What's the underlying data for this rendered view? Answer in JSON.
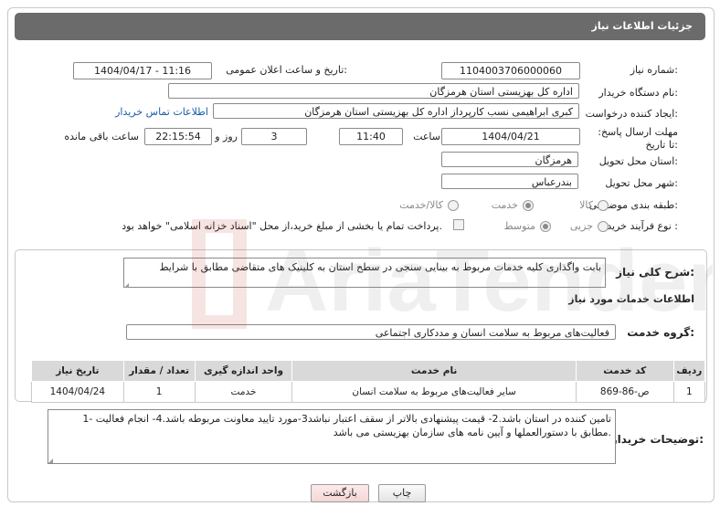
{
  "header": {
    "title": "جزئیات اطلاعات نیاز"
  },
  "fields": {
    "need_number_label": "شماره نیاز:",
    "need_number": "1104003706000060",
    "announce_label": "تاریخ و ساعت اعلان عمومی:",
    "announce_value": "1404/04/17 - 11:16",
    "buyer_label": "نام دستگاه خریدار:",
    "buyer_value": "اداره کل بهزیستی استان هرمزگان",
    "creator_label": "ایجاد کننده درخواست:",
    "creator_value": "کبری  ابراهیمی نسب کارپرداز اداره کل بهزیستی استان هرمزگان",
    "contact_link": "اطلاعات تماس خریدار",
    "deadline_label": "مهلت ارسال پاسخ: تا تاریخ:",
    "deadline_date": "1404/04/21",
    "time_label": "ساعت",
    "deadline_time": "11:40",
    "days_value": "3",
    "days_label": "روز و",
    "remaining_time": "22:15:54",
    "remaining_label": "ساعت باقی مانده",
    "province_label": "استان محل تحویل:",
    "province_value": "هرمزگان",
    "city_label": "شهر محل تحویل:",
    "city_value": "بندرعباس",
    "category_label": "طبقه بندی موضوعی:",
    "category_options": [
      "کالا",
      "خدمت",
      "کالا/خدمت"
    ],
    "process_label": "نوع فرآیند خرید :",
    "process_options": [
      "جزیی",
      "متوسط"
    ],
    "payment_note": "پرداخت تمام یا بخشی از مبلغ خرید،از محل \"اسناد خزانه اسلامی\" خواهد بود."
  },
  "summary": {
    "label": "شرح کلی نیاز:",
    "value": "بابت واگذاری کلیه خدمات مربوط به  بینایی سنجی در سطح استان به کلینیک های متقاضی مطابق با شرایط"
  },
  "services": {
    "section_title": "اطلاعات خدمات مورد نیاز",
    "group_label": "گروه خدمت:",
    "group_value": "فعالیت‌های مربوط به سلامت انسان و مددکاری اجتماعی",
    "columns": [
      "ردیف",
      "کد خدمت",
      "نام خدمت",
      "واحد اندازه گیری",
      "تعداد / مقدار",
      "تاریخ نیاز"
    ],
    "rows": [
      [
        "1",
        "ص-86-869",
        "سایر فعالیت‌های مربوط به سلامت انسان",
        "خدمت",
        "1",
        "1404/04/24"
      ]
    ]
  },
  "notes": {
    "label": "توضیحات خریدار:",
    "value": "1- تامین کننده در استان  باشد.2- قیمت پیشنهادی بالاتر از سقف اعتبار نباشد3-مورد تایید معاونت مربوطه باشد.4- انجام فعالیت مطابق با دستورالعملها و آیین نامه های سازمان بهزیستی می باشد."
  },
  "buttons": {
    "print": "چاپ",
    "back": "بازگشت"
  },
  "watermark_text": "AriaTender.neT"
}
